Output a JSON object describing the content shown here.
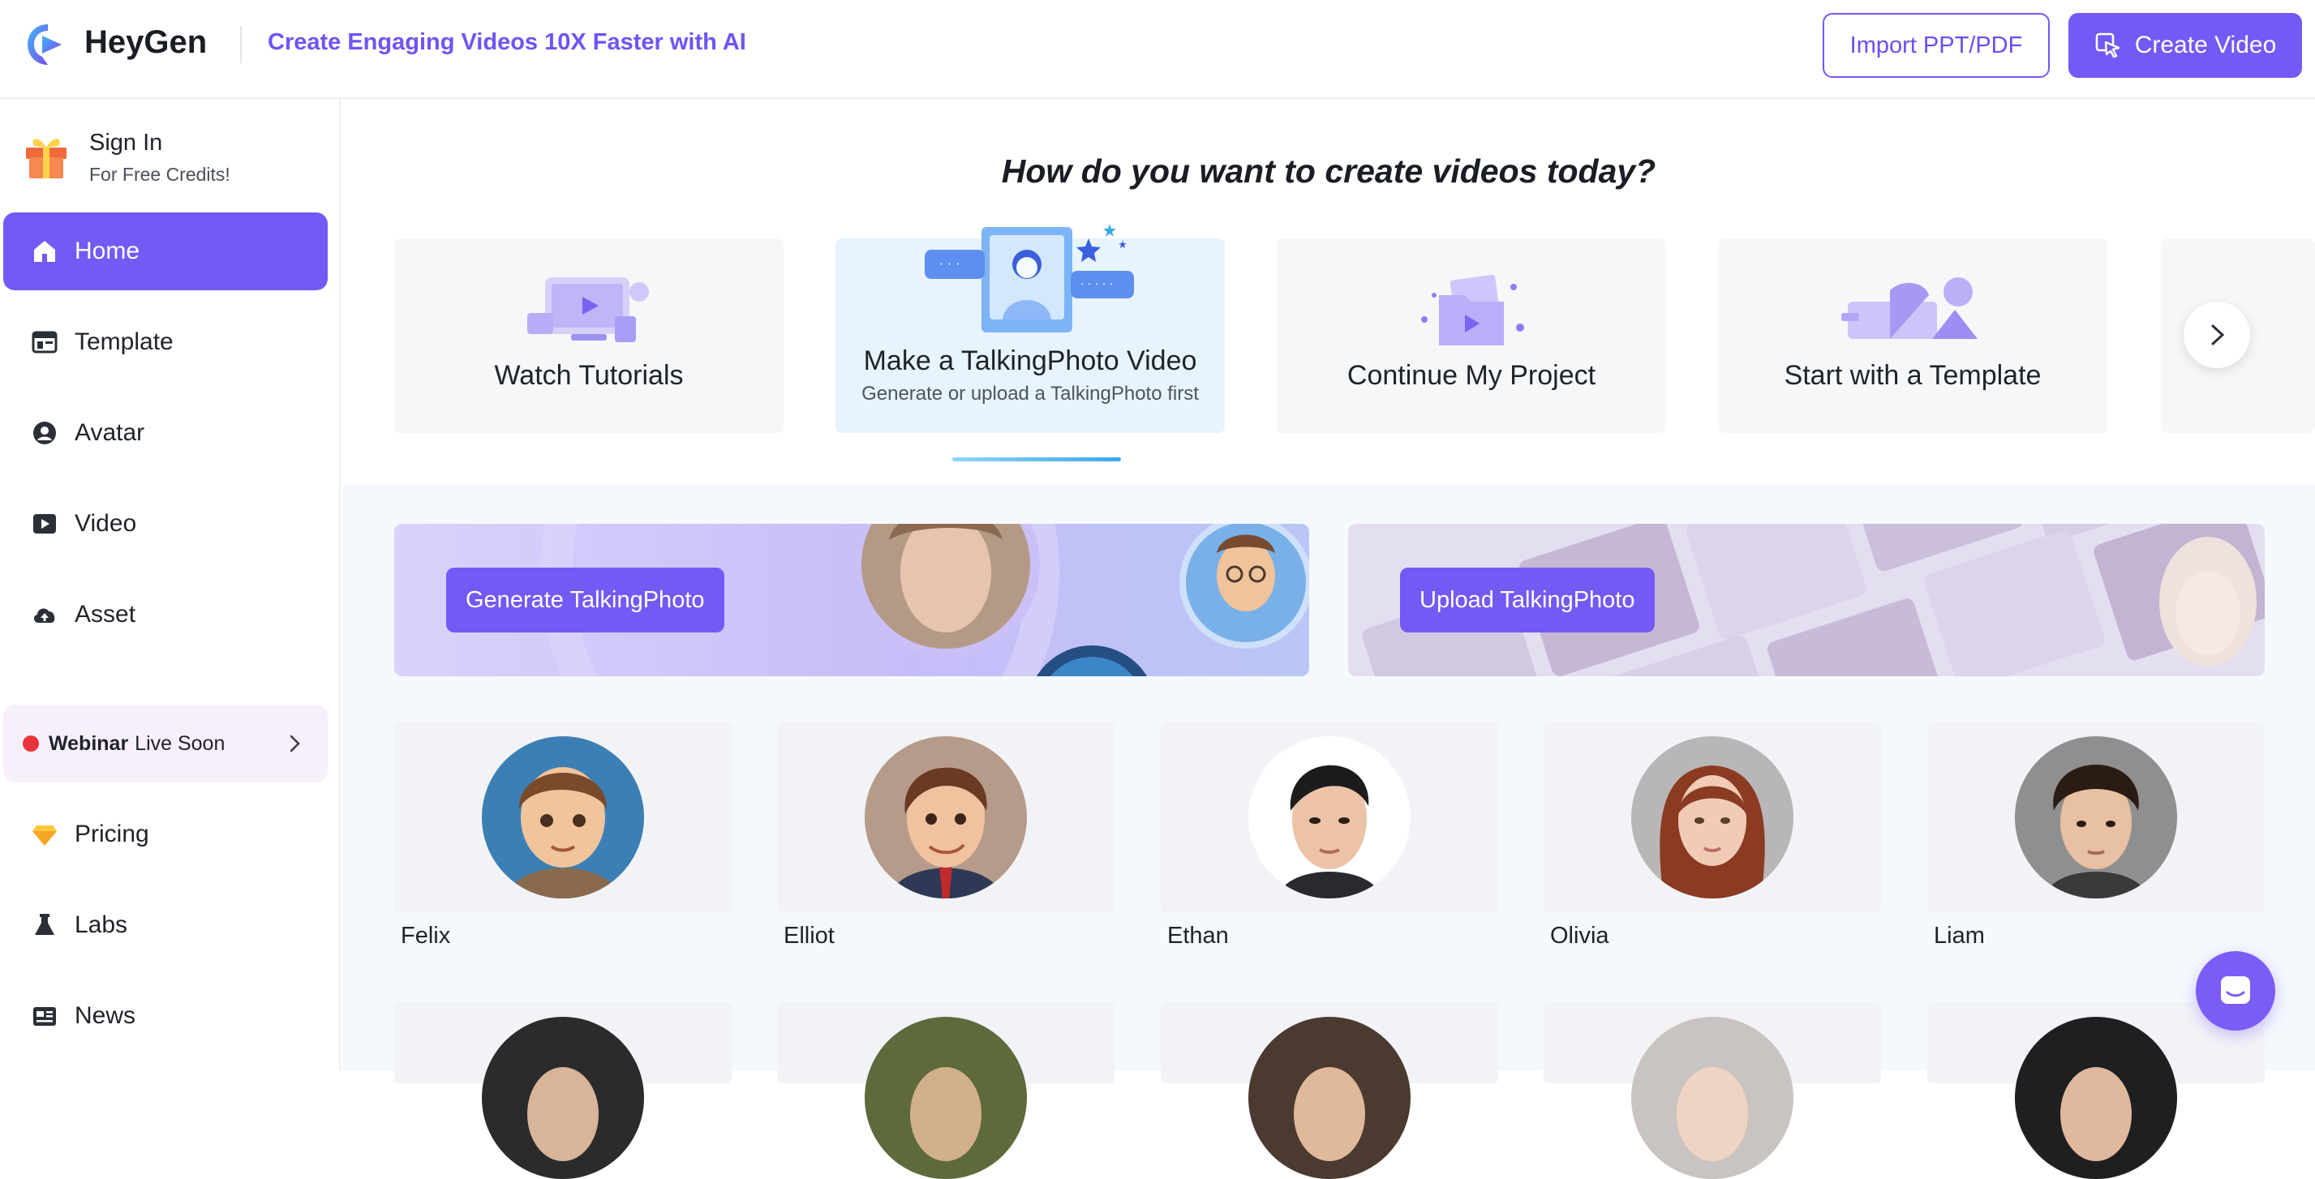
{
  "header": {
    "brand": "HeyGen",
    "slogan": "Create Engaging Videos 10X Faster with AI",
    "import_label": "Import PPT/PDF",
    "create_label": "Create Video"
  },
  "sidebar": {
    "signin_title": "Sign In",
    "signin_sub": "For Free Credits!",
    "items": [
      {
        "label": "Home"
      },
      {
        "label": "Template"
      },
      {
        "label": "Avatar"
      },
      {
        "label": "Video"
      },
      {
        "label": "Asset"
      }
    ],
    "webinar_bold": "Webinar",
    "webinar_text": "Live Soon",
    "items2": [
      {
        "label": "Pricing"
      },
      {
        "label": "Labs"
      },
      {
        "label": "News"
      }
    ]
  },
  "main": {
    "heading": "How do you want to create videos today?",
    "cards": [
      {
        "title": "Watch Tutorials"
      },
      {
        "title": "Make a TalkingPhoto Video",
        "subtitle": "Generate or upload a TalkingPhoto first"
      },
      {
        "title": "Continue My Project"
      },
      {
        "title": "Start with a Template"
      }
    ],
    "banners": {
      "generate_label": "Generate TalkingPhoto",
      "upload_label": "Upload TalkingPhoto"
    },
    "avatars": [
      {
        "name": "Felix"
      },
      {
        "name": "Elliot"
      },
      {
        "name": "Ethan"
      },
      {
        "name": "Olivia"
      },
      {
        "name": "Liam"
      }
    ]
  },
  "colors": {
    "accent": "#7559f5",
    "active_card": "#e7f3fd",
    "webinar_bg": "#f7f0fb",
    "live_dot": "#e8333b"
  }
}
